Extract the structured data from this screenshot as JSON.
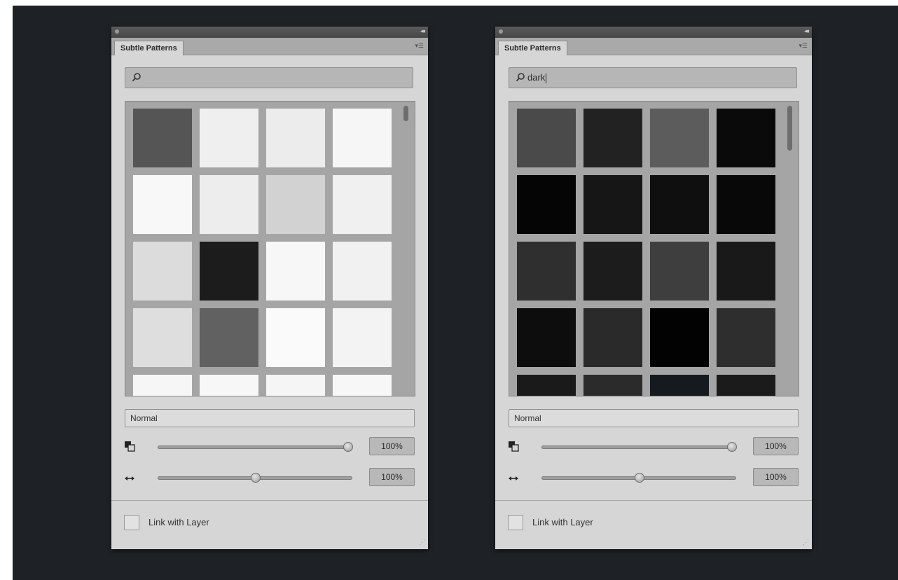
{
  "panels": [
    {
      "id": "left",
      "title": "Subtle Patterns",
      "search_value": "",
      "tiles": [
        "#555555",
        "#efefef",
        "#ececec",
        "#f6f6f6",
        "#f8f8f8",
        "#ededed",
        "#d2d2d2",
        "#f0f0f0",
        "#dcdcdc",
        "#1c1c1c",
        "#f7f7f7",
        "#f1f1f1",
        "#dedede",
        "#616161",
        "#fafafa",
        "#f3f3f3",
        "#f6f6f6",
        "#f7f7f7",
        "#f5f5f5",
        "#f7f7f7"
      ],
      "blend_mode": "Normal",
      "opacity_value": "100%",
      "opacity_level": 1.0,
      "scale_value": "100%",
      "scale_level": 0.5,
      "link_label": "Link with Layer"
    },
    {
      "id": "right",
      "title": "Subtle Patterns",
      "search_value": "dark",
      "tiles": [
        "#4a4a4a",
        "#222222",
        "#5c5c5c",
        "#0a0a0a",
        "#050505",
        "#161616",
        "#0f0f0f",
        "#080808",
        "#2f2f2f",
        "#1c1c1c",
        "#3e3e3e",
        "#191919",
        "#0d0d0d",
        "#2a2a2a",
        "#020202",
        "#2e2e2e",
        "#1a1a1a",
        "#2b2b2b",
        "#141a20",
        "#1b1b1b"
      ],
      "blend_mode": "Normal",
      "opacity_value": "100%",
      "opacity_level": 1.0,
      "scale_value": "100%",
      "scale_level": 0.5,
      "link_label": "Link with Layer"
    }
  ]
}
